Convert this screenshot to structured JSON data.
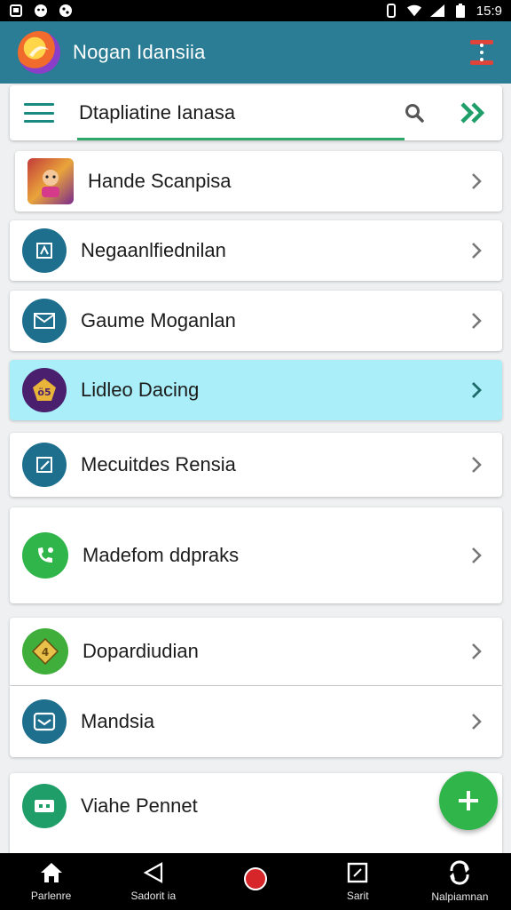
{
  "status_bar": {
    "time": "15:9"
  },
  "app_bar": {
    "title": "Nogan Idansiia"
  },
  "search": {
    "text": "Dtapliatine Ianasa"
  },
  "items": [
    {
      "label": "Hande Scanpisa",
      "icon": "game-thumbnail-icon",
      "highlighted": false
    },
    {
      "label": "Negaanlfiednilan",
      "icon": "document-icon",
      "highlighted": false
    },
    {
      "label": "Gaume Moganlan",
      "icon": "mail-icon",
      "highlighted": false
    },
    {
      "label": "Lidleo Dacing",
      "icon": "badge-icon",
      "highlighted": true
    },
    {
      "label": "Mecuitdes Rensia",
      "icon": "edit-icon",
      "highlighted": false
    },
    {
      "label": "Madefom ddpraks",
      "icon": "phone-icon",
      "highlighted": false
    },
    {
      "label": "Dopardiudian",
      "icon": "star-badge-icon",
      "highlighted": false
    },
    {
      "label": "Mandsia",
      "icon": "inbox-icon",
      "highlighted": false
    },
    {
      "label": "Viahe Pennet",
      "icon": "chat-icon",
      "highlighted": false
    }
  ],
  "bottom_nav": [
    {
      "label": "Parlenre",
      "icon": "home-icon"
    },
    {
      "label": "Sadorit ia",
      "icon": "back-triangle-icon"
    },
    {
      "label": "",
      "icon": "record-icon"
    },
    {
      "label": "Sarit",
      "icon": "square-icon"
    },
    {
      "label": "Nalpiamnan",
      "icon": "sync-icon"
    }
  ],
  "colors": {
    "app_bar": "#2a7d94",
    "highlight": "#a9eef8",
    "accent_green": "#2fb54a",
    "teal_icon": "#1e6f8e"
  }
}
